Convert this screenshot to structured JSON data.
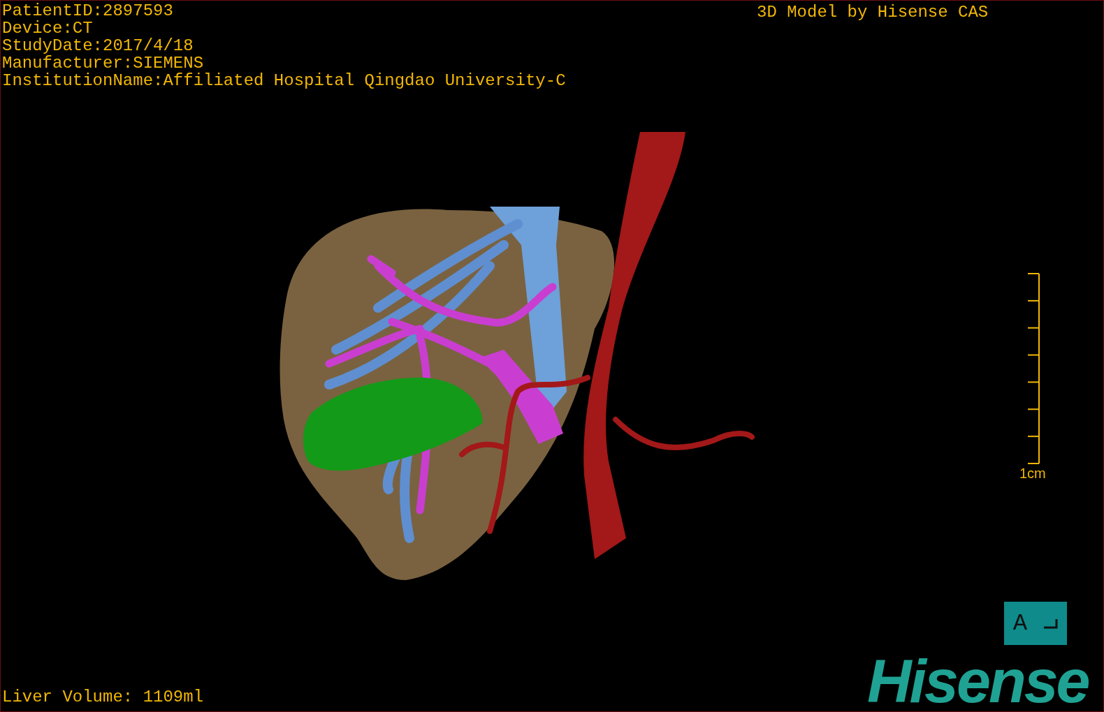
{
  "info_lines": [
    "PatientID:2897593",
    "Device:CT",
    "StudyDate:2017/4/18",
    "Manufacturer:SIEMENS",
    "InstitutionName:Affiliated Hospital Qingdao University-C"
  ],
  "title": "3D Model by Hisense CAS",
  "scale_bar": {
    "label": "1cm"
  },
  "orientation": {
    "label": "A"
  },
  "liver_volume": "Liver Volume: 1109ml",
  "logo": "Hisense"
}
